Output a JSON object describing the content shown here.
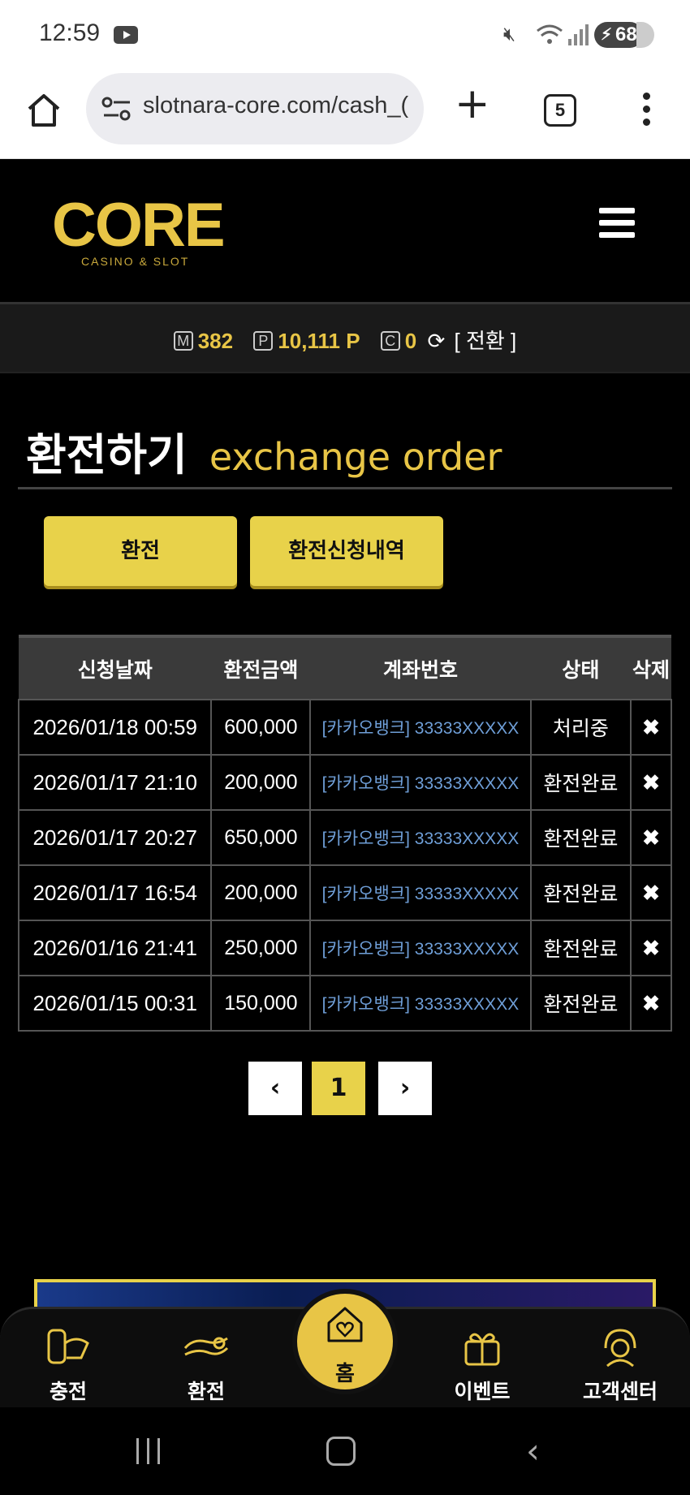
{
  "status_bar": {
    "time": "12:59",
    "battery": "68",
    "icons": [
      "youtube-icon",
      "mute-icon",
      "wifi-icon",
      "signal-icon",
      "battery-charging-icon"
    ]
  },
  "browser": {
    "url": "slotnara-core.com/cash_(",
    "tab_count": "5"
  },
  "site": {
    "logo_text": "CORE",
    "logo_sub": "CASINO & SLOT",
    "accent_color": "#e8c546"
  },
  "balance": {
    "money_icon": "M",
    "money_value": "382",
    "point_icon": "P",
    "point_value": "10,111 P",
    "comp_icon": "C",
    "comp_value": "0",
    "switch_label": "[ 전환 ]"
  },
  "page": {
    "title_ko": "환전하기",
    "title_en": "exchange order"
  },
  "buttons": {
    "exchange": "환전",
    "history": "환전신청내역"
  },
  "table": {
    "headers": [
      "신청날짜",
      "환전금액",
      "계좌번호",
      "상태",
      "삭제"
    ],
    "rows": [
      {
        "date": "2026/01/18 00:59",
        "amount": "600,000",
        "account": "[카카오뱅크] 33333XXXXX",
        "status": "처리중"
      },
      {
        "date": "2026/01/17 21:10",
        "amount": "200,000",
        "account": "[카카오뱅크] 33333XXXXX",
        "status": "환전완료"
      },
      {
        "date": "2026/01/17 20:27",
        "amount": "650,000",
        "account": "[카카오뱅크] 33333XXXXX",
        "status": "환전완료"
      },
      {
        "date": "2026/01/17 16:54",
        "amount": "200,000",
        "account": "[카카오뱅크] 33333XXXXX",
        "status": "환전완료"
      },
      {
        "date": "2026/01/16 21:41",
        "amount": "250,000",
        "account": "[카카오뱅크] 33333XXXXX",
        "status": "환전완료"
      },
      {
        "date": "2026/01/15 00:31",
        "amount": "150,000",
        "account": "[카카오뱅크] 33333XXXXX",
        "status": "환전완료"
      }
    ],
    "delete_glyph": "✖"
  },
  "pagination": {
    "prev": "‹",
    "current": "1",
    "next": "›"
  },
  "bottom_nav": {
    "charge": "충전",
    "exchange": "환전",
    "home": "홈",
    "event": "이벤트",
    "support": "고객센터"
  }
}
